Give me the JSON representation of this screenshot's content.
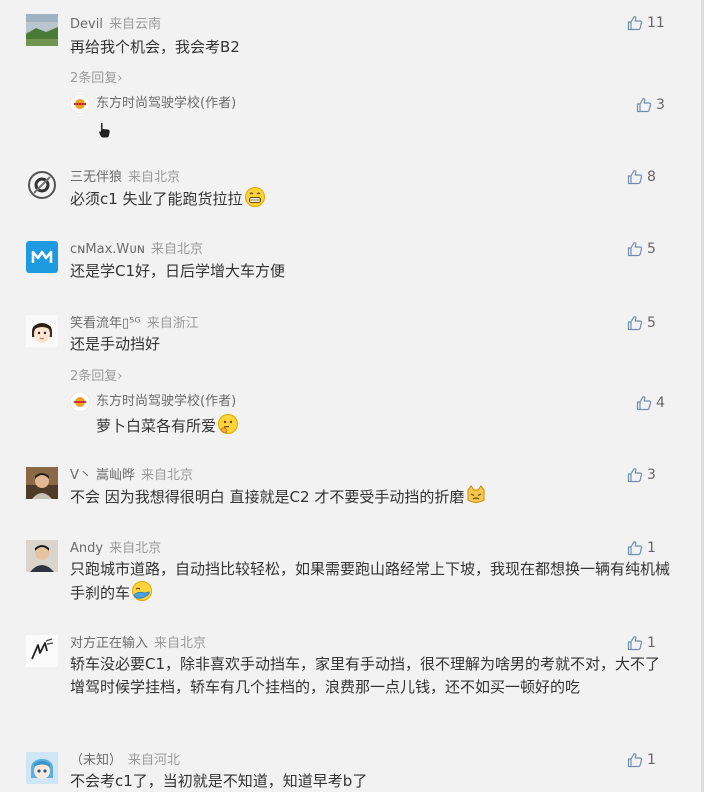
{
  "comments": [
    {
      "user": "Devil",
      "location": "来自云南",
      "text": "再给我个机会，我会考B2",
      "likes": "11",
      "avatar_icon": "landscape-avatar-icon",
      "replies_label": "2条回复",
      "reply": {
        "user": "东方时尚驾驶学校(作者)",
        "text": "",
        "likes": "3",
        "avatar_icon": "school-logo-icon",
        "emoji_icon": "pointing-hand-icon"
      }
    },
    {
      "user": "三无伴狼",
      "location": "来自北京",
      "text": "必须c1 失业了能跑货拉拉",
      "likes": "8",
      "avatar_icon": "circle-emblem-avatar-icon",
      "emoji_icon": "grin-emoji-icon"
    },
    {
      "user": "cɴMax.Wᴜɴ",
      "location": "来自北京",
      "text": "还是学C1好，日后学增大车方便",
      "likes": "5",
      "avatar_icon": "blue-logo-avatar-icon"
    },
    {
      "user": "笑看流年▯⁵ᴳ",
      "location": "来自浙江",
      "text": "还是手动挡好",
      "likes": "5",
      "avatar_icon": "cartoon-girl-avatar-icon",
      "replies_label": "2条回复",
      "reply": {
        "user": "东方时尚驾驶学校(作者)",
        "text": "萝卜白菜各有所爱",
        "likes": "4",
        "avatar_icon": "school-logo-icon",
        "emoji_icon": "thinking-emoji-icon"
      }
    },
    {
      "user": "V丶 嵩屾晔",
      "location": "来自北京",
      "text": "不会 因为我想得很明白 直接就是C2 才不要受手动挡的折磨",
      "likes": "3",
      "avatar_icon": "photo-avatar-icon",
      "emoji_icon": "cat-emoji-icon"
    },
    {
      "user": "Andy",
      "location": "来自北京",
      "text": "只跑城市道路，自动挡比较轻松，如果需要跑山路经常上下坡，我现在都想换一辆有纯机械手刹的车",
      "likes": "1",
      "avatar_icon": "man-photo-avatar-icon",
      "emoji_icon": "facepalm-emoji-icon"
    },
    {
      "user": "对方正在输入",
      "location": "来自北京",
      "text": "轿车没必要C1，除非喜欢手动挡车，家里有手动挡，很不理解为啥男的考就不对，大不了增驾时候学挂档，轿车有几个挂档的，浪费那一点儿钱，还不如买一顿好的吃",
      "likes": "1",
      "avatar_icon": "sketch-avatar-icon"
    },
    {
      "user": "（未知）",
      "location": "来自河北",
      "text": "不会考c1了，当初就是不知道，知道早考b了",
      "likes": "1",
      "avatar_icon": "anime-avatar-icon"
    }
  ],
  "colors": {
    "background": "#f2f2f2",
    "username": "#6b6b6b",
    "location": "#9a9a9a",
    "text": "#333333",
    "like_icon": "#6f8fb0"
  }
}
